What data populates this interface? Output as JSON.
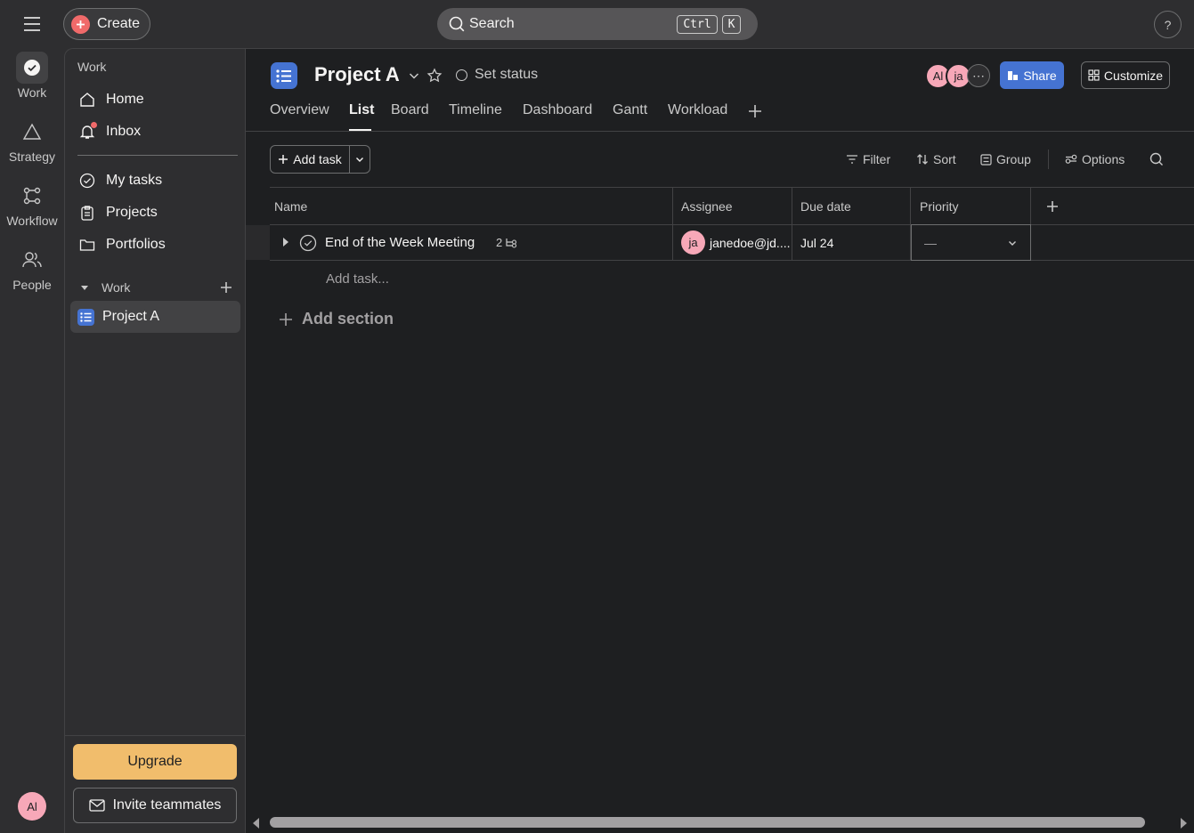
{
  "topbar": {
    "create_label": "Create",
    "search_label": "Search",
    "search_kbd_1": "Ctrl",
    "search_kbd_2": "K",
    "help_label": "?"
  },
  "rail": {
    "items": [
      {
        "label": "Work",
        "icon": "check-circle-icon"
      },
      {
        "label": "Strategy",
        "icon": "triangle-icon"
      },
      {
        "label": "Workflow",
        "icon": "workflow-icon"
      },
      {
        "label": "People",
        "icon": "people-icon"
      }
    ],
    "user_initials": "Al"
  },
  "sidebar": {
    "heading": "Work",
    "nav": [
      {
        "label": "Home",
        "icon": "home-icon"
      },
      {
        "label": "Inbox",
        "icon": "bell-icon"
      }
    ],
    "nav2": [
      {
        "label": "My tasks",
        "icon": "check-circle-icon"
      },
      {
        "label": "Projects",
        "icon": "clipboard-icon"
      },
      {
        "label": "Portfolios",
        "icon": "folder-icon"
      }
    ],
    "section_label": "Work",
    "projects": [
      {
        "label": "Project A",
        "icon": "list-icon"
      }
    ],
    "upgrade_label": "Upgrade",
    "invite_label": "Invite teammates"
  },
  "project": {
    "title": "Project A",
    "set_status": "Set status",
    "members": [
      "Al",
      "ja"
    ],
    "share_label": "Share",
    "customize_label": "Customize",
    "tabs": [
      "Overview",
      "List",
      "Board",
      "Timeline",
      "Dashboard",
      "Gantt",
      "Workload"
    ],
    "active_tab": "List"
  },
  "toolbar": {
    "add_task_label": "Add task",
    "filter_label": "Filter",
    "sort_label": "Sort",
    "group_label": "Group",
    "options_label": "Options"
  },
  "table": {
    "columns": [
      "Name",
      "Assignee",
      "Due date",
      "Priority"
    ],
    "rows": [
      {
        "name": "End of the Week Meeting",
        "subtasks": "2",
        "assignee_initials": "ja",
        "assignee": "janedoe@jd....",
        "due": "Jul 24",
        "priority": "—"
      }
    ],
    "add_task_placeholder": "Add task...",
    "add_section_label": "Add section"
  },
  "colors": {
    "accent_blue": "#4573d2",
    "create_red": "#f06a6a",
    "upgrade_orange": "#f1bd6c",
    "avatar_pink": "#f7a8b8"
  }
}
